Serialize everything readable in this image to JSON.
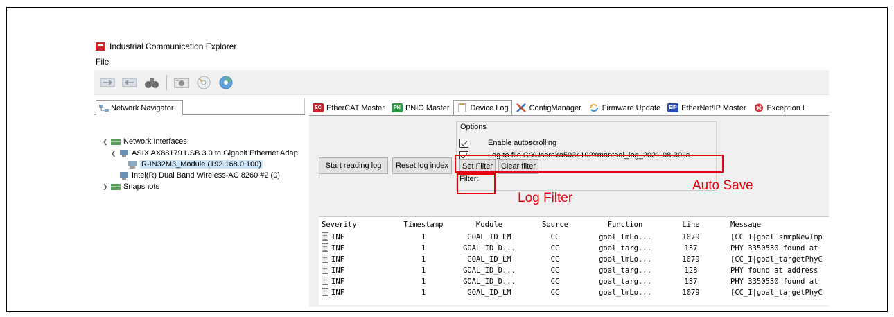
{
  "window": {
    "title": "Industrial Communication Explorer"
  },
  "menu": {
    "file": "File"
  },
  "navigator": {
    "tab_label": "Network Navigator",
    "tree": {
      "network_interfaces": "Network Interfaces",
      "adapter": "ASIX AX88179 USB 3.0 to Gigabit Ethernet Adap",
      "module": "R-IN32M3_Module (192.168.0.100)",
      "wireless": "Intel(R) Dual Band Wireless-AC 8260 #2 (0)",
      "snapshots": "Snapshots"
    }
  },
  "tabs": [
    {
      "label": "EtherCAT Master",
      "icon": "ethercat-icon"
    },
    {
      "label": "PNIO Master",
      "icon": "profinet-icon"
    },
    {
      "label": "Device Log",
      "icon": "clipboard-icon"
    },
    {
      "label": "ConfigManager",
      "icon": "tools-icon"
    },
    {
      "label": "Firmware Update",
      "icon": "update-icon"
    },
    {
      "label": "EtherNet/IP Master",
      "icon": "eip-icon"
    },
    {
      "label": "Exception L",
      "icon": "error-icon"
    }
  ],
  "device_log": {
    "start_reading": "Start reading log",
    "reset_index": "Reset log index",
    "options_label": "Options",
    "autoscroll_label": "Enable autoscrolling",
    "log_to_file_label": "Log to file C:¥Users¥a5034192¥mantool_log_2021-08-30.lc",
    "set_filter": "Set Filter",
    "clear_filter": "Clear filter",
    "filter_label": "Filter:"
  },
  "annotations": {
    "log_filter": "Log Filter",
    "auto_save": "Auto Save",
    "color": "#e8000b"
  },
  "log_columns": [
    "Severity",
    "Timestamp",
    "Module",
    "Source",
    "Function",
    "Line",
    "Message"
  ],
  "log_rows": [
    [
      "INF",
      "1",
      "GOAL_ID_LM",
      "CC",
      "goal_lmLo...",
      "1079",
      "[CC_I|goal_snmpNewImp"
    ],
    [
      "INF",
      "1",
      "GOAL_ID_D...",
      "CC",
      "goal_targ...",
      "137",
      "PHY 3350530 found at"
    ],
    [
      "INF",
      "1",
      "GOAL_ID_LM",
      "CC",
      "goal_lmLo...",
      "1079",
      "[CC_I|goal_targetPhyC"
    ],
    [
      "INF",
      "1",
      "GOAL_ID_D...",
      "CC",
      "goal_targ...",
      "128",
      "PHY found at address"
    ],
    [
      "INF",
      "1",
      "GOAL_ID_D...",
      "CC",
      "goal_targ...",
      "137",
      "PHY 3350530 found at"
    ],
    [
      "INF",
      "1",
      "GOAL_ID_LM",
      "CC",
      "goal_lmLo...",
      "1079",
      "[CC_I|goal_targetPhyC"
    ]
  ]
}
